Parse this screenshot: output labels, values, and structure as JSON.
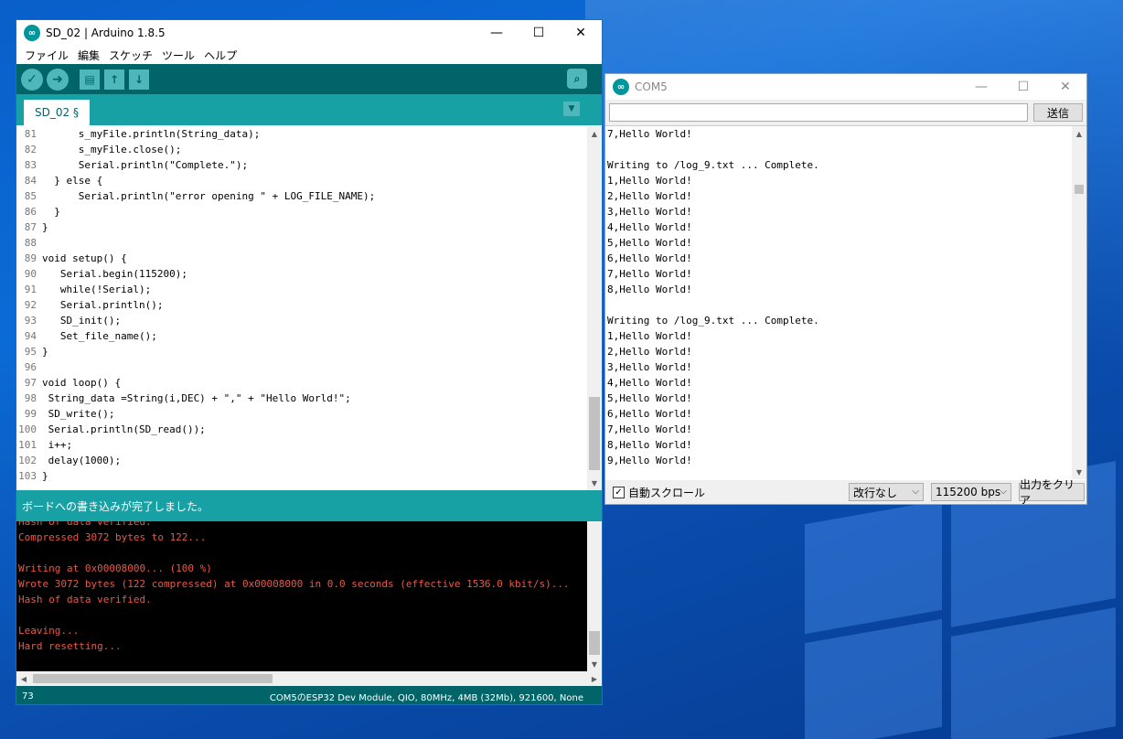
{
  "arduino": {
    "title": "SD_02 | Arduino 1.8.5",
    "icon": "arduino-logo",
    "menu": [
      "ファイル",
      "編集",
      "スケッチ",
      "ツール",
      "ヘルプ"
    ],
    "tab_label": "SD_02 §",
    "code_lines": [
      {
        "n": "81",
        "text": "      s_myFile.println(String_data);"
      },
      {
        "n": "82",
        "text": "      s_myFile.close();"
      },
      {
        "n": "83",
        "text": "      Serial.println(\"Complete.\");"
      },
      {
        "n": "84",
        "text": "  } else {"
      },
      {
        "n": "85",
        "text": "      Serial.println(\"error opening \" + LOG_FILE_NAME);"
      },
      {
        "n": "86",
        "text": "  }"
      },
      {
        "n": "87",
        "text": "}"
      },
      {
        "n": "88",
        "text": ""
      },
      {
        "n": "89",
        "text": "void setup() {"
      },
      {
        "n": "90",
        "text": "   Serial.begin(115200);"
      },
      {
        "n": "91",
        "text": "   while(!Serial);"
      },
      {
        "n": "92",
        "text": "   Serial.println();"
      },
      {
        "n": "93",
        "text": "   SD_init();"
      },
      {
        "n": "94",
        "text": "   Set_file_name();"
      },
      {
        "n": "95",
        "text": "}"
      },
      {
        "n": "96",
        "text": ""
      },
      {
        "n": "97",
        "text": "void loop() {"
      },
      {
        "n": "98",
        "text": " String_data =String(i,DEC) + \",\" + \"Hello World!\";"
      },
      {
        "n": "99",
        "text": " SD_write();"
      },
      {
        "n": "100",
        "text": " Serial.println(SD_read());"
      },
      {
        "n": "101",
        "text": " i++;"
      },
      {
        "n": "102",
        "text": " delay(1000);"
      },
      {
        "n": "103",
        "text": "}"
      }
    ],
    "status_message": "ボードへの書き込みが完了しました。",
    "console_lines": [
      "Hash of data verified.",
      "Compressed 3072 bytes to 122...",
      "",
      "Writing at 0x00008000... (100 %)",
      "Wrote 3072 bytes (122 compressed) at 0x00008000 in 0.0 seconds (effective 1536.0 kbit/s)...",
      "Hash of data verified.",
      "",
      "Leaving...",
      "Hard resetting..."
    ],
    "cursor_line": "73",
    "board_info": "COM5のESP32 Dev Module, QIO, 80MHz, 4MB (32Mb), 921600, None"
  },
  "serial_monitor": {
    "title": "COM5",
    "send_input_value": "",
    "send_label": "送信",
    "output_lines": [
      "7,Hello World!",
      "",
      "Writing to /log_9.txt ... Complete.",
      "1,Hello World!",
      "2,Hello World!",
      "3,Hello World!",
      "4,Hello World!",
      "5,Hello World!",
      "6,Hello World!",
      "7,Hello World!",
      "8,Hello World!",
      "",
      "Writing to /log_9.txt ... Complete.",
      "1,Hello World!",
      "2,Hello World!",
      "3,Hello World!",
      "4,Hello World!",
      "5,Hello World!",
      "6,Hello World!",
      "7,Hello World!",
      "8,Hello World!",
      "9,Hello World!"
    ],
    "autoscroll_label": "自動スクロール",
    "autoscroll_checked": true,
    "line_ending": "改行なし",
    "baud_rate": "115200 bps",
    "clear_label": "出力をクリア"
  },
  "colors": {
    "arduino_dark": "#006468",
    "arduino_teal": "#17a1a5",
    "console_text": "#e6594a",
    "desktop_blue": "#0a5fc9"
  }
}
